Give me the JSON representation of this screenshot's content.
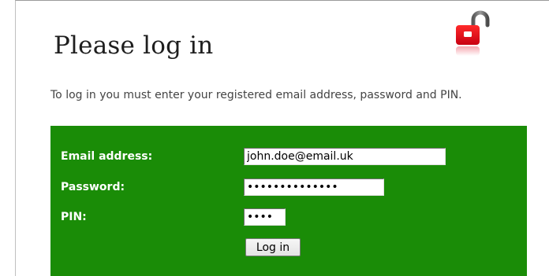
{
  "page": {
    "title": "Please log in",
    "intro": "To log in you must enter your registered email address, password and PIN."
  },
  "form": {
    "email_label": "Email address:",
    "email_value": "john.doe@email.uk",
    "password_label": "Password:",
    "password_value": "••••••••••••••",
    "pin_label": "PIN:",
    "pin_value": "••••",
    "login_button": "Log in"
  },
  "icons": {
    "lock": "padlock-open-icon"
  },
  "colors": {
    "panel_green": "#1a8c07",
    "lock_red": "#e3001b",
    "label_text": "#ffffff"
  }
}
